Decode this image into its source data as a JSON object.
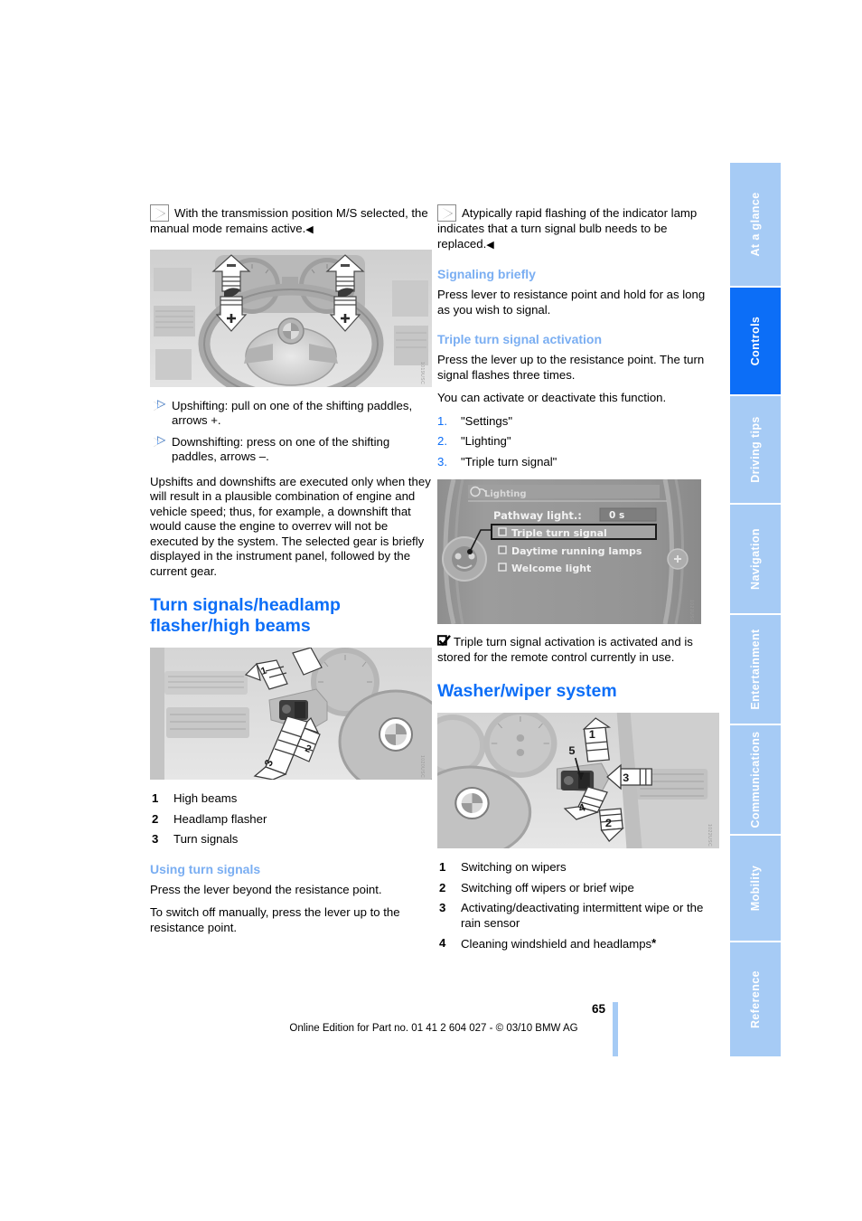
{
  "document": {
    "page_number": "65",
    "footer": "Online Edition for Part no. 01 41 2 604 027 - © 03/10 BMW AG"
  },
  "sidebar": {
    "tabs": [
      {
        "label": "At a glance",
        "active": false
      },
      {
        "label": "Controls",
        "active": true
      },
      {
        "label": "Driving tips",
        "active": false
      },
      {
        "label": "Navigation",
        "active": false
      },
      {
        "label": "Entertainment",
        "active": false
      },
      {
        "label": "Communications",
        "active": false
      },
      {
        "label": "Mobility",
        "active": false
      },
      {
        "label": "Reference",
        "active": false
      }
    ],
    "colors": {
      "inactive": "#a6cbf5",
      "active": "#0c6ef7",
      "text": "#ffffff"
    }
  },
  "colors": {
    "heading_blue": "#0c6ef7",
    "subheading_blue": "#7aaef2",
    "bullet_blue": "#5b9bf0",
    "figure_gray": "#d9d9d9"
  },
  "left_column": {
    "note_1": {
      "icon": "triangle-right-note-icon",
      "text": "With the transmission position M/S selected, the manual mode remains active.",
      "end_mark": "◀"
    },
    "figure_paddles": {
      "name": "steering-wheel-shift-paddles-illustration",
      "watermark": "1019USC"
    },
    "bullets": [
      "Upshifting: pull on one of the shifting paddles, arrows +.",
      "Downshifting: press on one of the shifting paddles, arrows –."
    ],
    "paragraph": "Upshifts and downshifts are executed only when they will result in a plausible combination of engine and vehicle speed; thus, for example, a downshift that would cause the engine to overrev will not be executed by the system. The selected gear is briefly displayed in the instrument panel, followed by the current gear.",
    "section_heading": "Turn signals/headlamp flasher/high beams",
    "figure_stalk": {
      "name": "turn-signal-stalk-illustration",
      "watermark": "1020USC"
    },
    "legend": [
      {
        "num": "1",
        "text": "High beams"
      },
      {
        "num": "2",
        "text": "Headlamp flasher"
      },
      {
        "num": "3",
        "text": "Turn signals"
      }
    ],
    "subheading": "Using turn signals",
    "para_1": "Press the lever beyond the resistance point.",
    "para_2": "To switch off manually, press the lever up to the resistance point."
  },
  "right_column": {
    "note_1": {
      "icon": "triangle-right-note-icon",
      "text": "Atypically rapid flashing of the indicator lamp indicates that a turn signal bulb needs to be replaced.",
      "end_mark": "◀"
    },
    "sub_signaling": "Signaling briefly",
    "para_signaling": "Press lever to resistance point and hold for as long as you wish to signal.",
    "sub_triple": "Triple turn signal activation",
    "para_triple_1": "Press the lever up to the resistance point. The turn signal flashes three times.",
    "para_triple_2": "You can activate or deactivate this function.",
    "steps": [
      {
        "num": "1.",
        "text": "\"Settings\""
      },
      {
        "num": "2.",
        "text": "\"Lighting\""
      },
      {
        "num": "3.",
        "text": "\"Triple turn signal\""
      }
    ],
    "idrive": {
      "name": "idrive-lighting-menu-screenshot",
      "title": "Lighting",
      "title_icon": "lighting-menu-icon",
      "rows": [
        {
          "label": "Pathway light:",
          "value": "0 s",
          "type": "value",
          "selected": false
        },
        {
          "label": "Triple turn signal",
          "type": "checkbox",
          "checked": false,
          "selected": true
        },
        {
          "label": "Daytime running lamps",
          "type": "checkbox",
          "checked": false,
          "selected": false
        },
        {
          "label": "Welcome light",
          "type": "checkbox",
          "checked": false,
          "selected": false
        }
      ],
      "watermark": "1021USC"
    },
    "check_note": {
      "icon": "checked-box-icon",
      "text": "Triple turn signal activation is activated and is stored for the remote control currently in use."
    },
    "section_heading": "Washer/wiper system",
    "figure_wiper": {
      "name": "washer-wiper-stalk-illustration",
      "watermark": "1022USC"
    },
    "legend": [
      {
        "num": "1",
        "text": "Switching on wipers"
      },
      {
        "num": "2",
        "text": "Switching off wipers or brief wipe"
      },
      {
        "num": "3",
        "text": "Activating/deactivating intermittent wipe or the rain sensor"
      },
      {
        "num": "4",
        "text": "Cleaning windshield and headlamps",
        "star": "*"
      }
    ]
  }
}
